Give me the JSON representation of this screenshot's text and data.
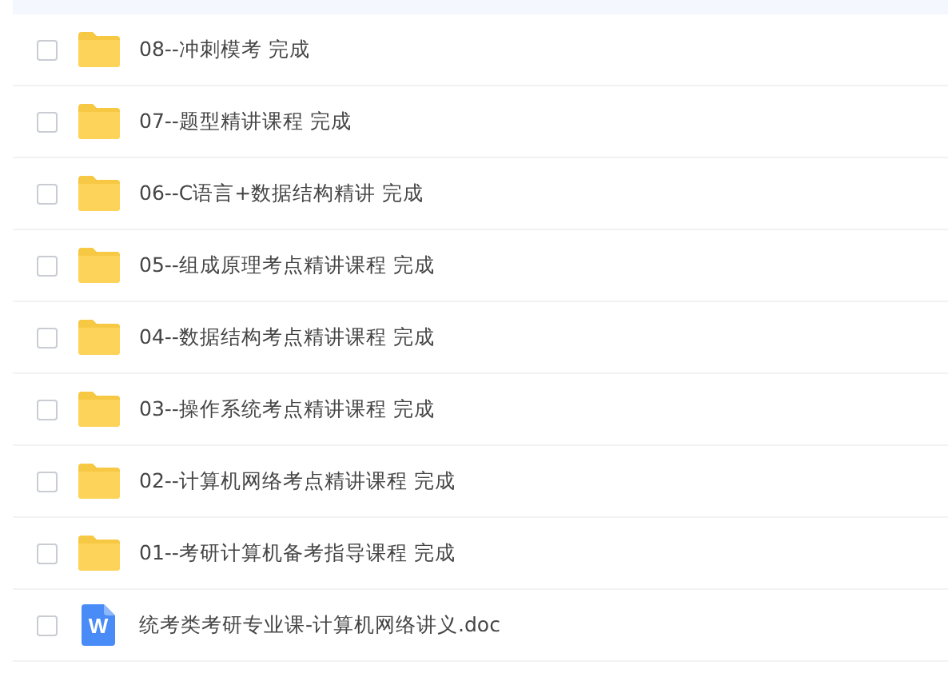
{
  "files": [
    {
      "kind": "folder",
      "name": "08--冲刺模考 完成",
      "checked": false
    },
    {
      "kind": "folder",
      "name": "07--题型精讲课程 完成",
      "checked": false
    },
    {
      "kind": "folder",
      "name": "06--C语言+数据结构精讲 完成",
      "checked": false
    },
    {
      "kind": "folder",
      "name": "05--组成原理考点精讲课程 完成",
      "checked": false
    },
    {
      "kind": "folder",
      "name": "04--数据结构考点精讲课程 完成",
      "checked": false
    },
    {
      "kind": "folder",
      "name": "03--操作系统考点精讲课程 完成",
      "checked": false
    },
    {
      "kind": "folder",
      "name": "02--计算机网络考点精讲课程 完成",
      "checked": false
    },
    {
      "kind": "folder",
      "name": "01--考研计算机备考指导课程 完成",
      "checked": false
    },
    {
      "kind": "doc",
      "name": "统考类考研专业课-计算机网络讲义.doc",
      "icon_letter": "W",
      "checked": false
    }
  ]
}
